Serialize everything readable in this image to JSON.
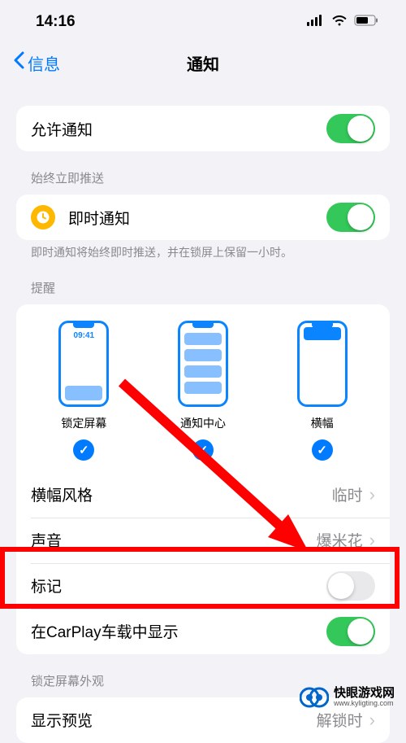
{
  "status": {
    "time": "14:16"
  },
  "nav": {
    "back": "信息",
    "title": "通知"
  },
  "allow": {
    "label": "允许通知",
    "on": true
  },
  "immediate": {
    "header": "始终立即推送",
    "label": "即时通知",
    "on": true,
    "footer": "即时通知将始终即时推送，并在锁屏上保留一小时。"
  },
  "alerts": {
    "header": "提醒",
    "options": [
      {
        "label": "锁定屏幕",
        "checked": true,
        "time": "09:41"
      },
      {
        "label": "通知中心",
        "checked": true
      },
      {
        "label": "横幅",
        "checked": true
      }
    ]
  },
  "rows": {
    "banner_style": {
      "label": "横幅风格",
      "value": "临时"
    },
    "sound": {
      "label": "声音",
      "value": "爆米花"
    },
    "badges": {
      "label": "标记",
      "on": false
    },
    "carplay": {
      "label": "在CarPlay车载中显示",
      "on": true
    }
  },
  "appearance": {
    "header": "锁定屏幕外观",
    "preview": {
      "label": "显示预览",
      "value": "解锁时"
    }
  },
  "watermark": {
    "name": "快眼游戏网",
    "url": "www.kyligting.com"
  },
  "colors": {
    "accent": "#007aff",
    "green": "#34c759",
    "red": "#ff0000"
  }
}
